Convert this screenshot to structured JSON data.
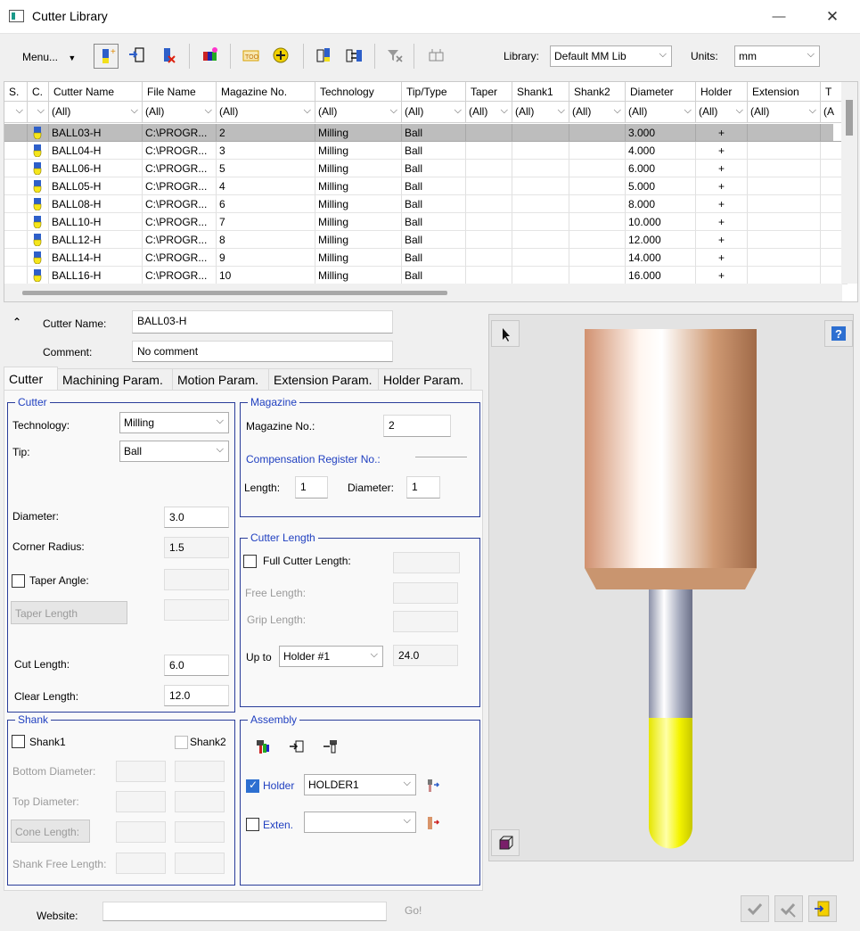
{
  "window": {
    "title": "Cutter Library",
    "minimize": "—",
    "maximize": "☐",
    "close": "✕"
  },
  "toolbar": {
    "menu_label": "Menu...",
    "library_label": "Library:",
    "library_value": "Default MM Lib",
    "units_label": "Units:",
    "units_value": "mm"
  },
  "grid": {
    "columns": [
      "S.",
      "C.",
      "Cutter Name",
      "File Name",
      "Magazine No.",
      "Technology",
      "Tip/Type",
      "Taper",
      "Shank1",
      "Shank2",
      "Diameter",
      "Holder",
      "Extension",
      "T"
    ],
    "filters": [
      "",
      "",
      "(All)",
      "(All)",
      "(All)",
      "(All)",
      "(All)",
      "(All)",
      "(All)",
      "(All)",
      "(All)",
      "(All)",
      "(All)",
      "(A"
    ],
    "rows": [
      {
        "name": "BALL03-H",
        "file": "C:\\PROGR...",
        "mag": "2",
        "tech": "Milling",
        "tip": "Ball",
        "dia": "3.000",
        "holder": "+"
      },
      {
        "name": "BALL04-H",
        "file": "C:\\PROGR...",
        "mag": "3",
        "tech": "Milling",
        "tip": "Ball",
        "dia": "4.000",
        "holder": "+"
      },
      {
        "name": "BALL06-H",
        "file": "C:\\PROGR...",
        "mag": "5",
        "tech": "Milling",
        "tip": "Ball",
        "dia": "6.000",
        "holder": "+"
      },
      {
        "name": "BALL05-H",
        "file": "C:\\PROGR...",
        "mag": "4",
        "tech": "Milling",
        "tip": "Ball",
        "dia": "5.000",
        "holder": "+"
      },
      {
        "name": "BALL08-H",
        "file": "C:\\PROGR...",
        "mag": "6",
        "tech": "Milling",
        "tip": "Ball",
        "dia": "8.000",
        "holder": "+"
      },
      {
        "name": "BALL10-H",
        "file": "C:\\PROGR...",
        "mag": "7",
        "tech": "Milling",
        "tip": "Ball",
        "dia": "10.000",
        "holder": "+"
      },
      {
        "name": "BALL12-H",
        "file": "C:\\PROGR...",
        "mag": "8",
        "tech": "Milling",
        "tip": "Ball",
        "dia": "12.000",
        "holder": "+"
      },
      {
        "name": "BALL14-H",
        "file": "C:\\PROGR...",
        "mag": "9",
        "tech": "Milling",
        "tip": "Ball",
        "dia": "14.000",
        "holder": "+"
      },
      {
        "name": "BALL16-H",
        "file": "C:\\PROGR...",
        "mag": "10",
        "tech": "Milling",
        "tip": "Ball",
        "dia": "16.000",
        "holder": "+"
      }
    ]
  },
  "details": {
    "cutter_name_label": "Cutter Name:",
    "cutter_name_value": "BALL03-H",
    "comment_label": "Comment:",
    "comment_value": "No comment"
  },
  "tabs": [
    "Cutter",
    "Machining Param.",
    "Motion Param.",
    "Extension Param.",
    "Holder Param."
  ],
  "cutter_group": {
    "title": "Cutter",
    "technology_label": "Technology:",
    "technology_value": "Milling",
    "tip_label": "Tip:",
    "tip_value": "Ball",
    "diameter_label": "Diameter:",
    "diameter_value": "3.0",
    "corner_radius_label": "Corner Radius:",
    "corner_radius_value": "1.5",
    "taper_angle_label": "Taper Angle:",
    "taper_length_label": "Taper Length",
    "cut_length_label": "Cut Length:",
    "cut_length_value": "6.0",
    "clear_length_label": "Clear Length:",
    "clear_length_value": "12.0"
  },
  "magazine_group": {
    "title": "Magazine",
    "magazine_no_label": "Magazine No.:",
    "magazine_no_value": "2",
    "comp_register_label": "Compensation Register No.:",
    "length_label": "Length:",
    "length_value": "1",
    "diameter_label": "Diameter:",
    "diameter_value": "1"
  },
  "cutter_length_group": {
    "title": "Cutter Length",
    "full_label": "Full Cutter Length:",
    "free_label": "Free Length:",
    "grip_label": "Grip Length:",
    "upto_label": "Up to",
    "upto_value": "Holder #1",
    "upto_number": "24.0"
  },
  "shank_group": {
    "title": "Shank",
    "shank1_label": "Shank1",
    "shank2_label": "Shank2",
    "bottom_dia_label": "Bottom Diameter:",
    "top_dia_label": "Top Diameter:",
    "cone_len_label": "Cone Length:",
    "shank_free_label": "Shank Free Length:"
  },
  "assembly_group": {
    "title": "Assembly",
    "holder_label": "Holder",
    "holder_value": "HOLDER1",
    "exten_label": "Exten.",
    "exten_value": ""
  },
  "footer": {
    "website_label": "Website:",
    "website_value": "",
    "go_label": "Go!"
  },
  "colors": {
    "group_border": "#2a3d9a",
    "group_title": "#1f3fc0",
    "holder_copper": "#d9a07e",
    "tool_yellow": "#f5f516",
    "shank_gray": "#9aa0b8"
  }
}
